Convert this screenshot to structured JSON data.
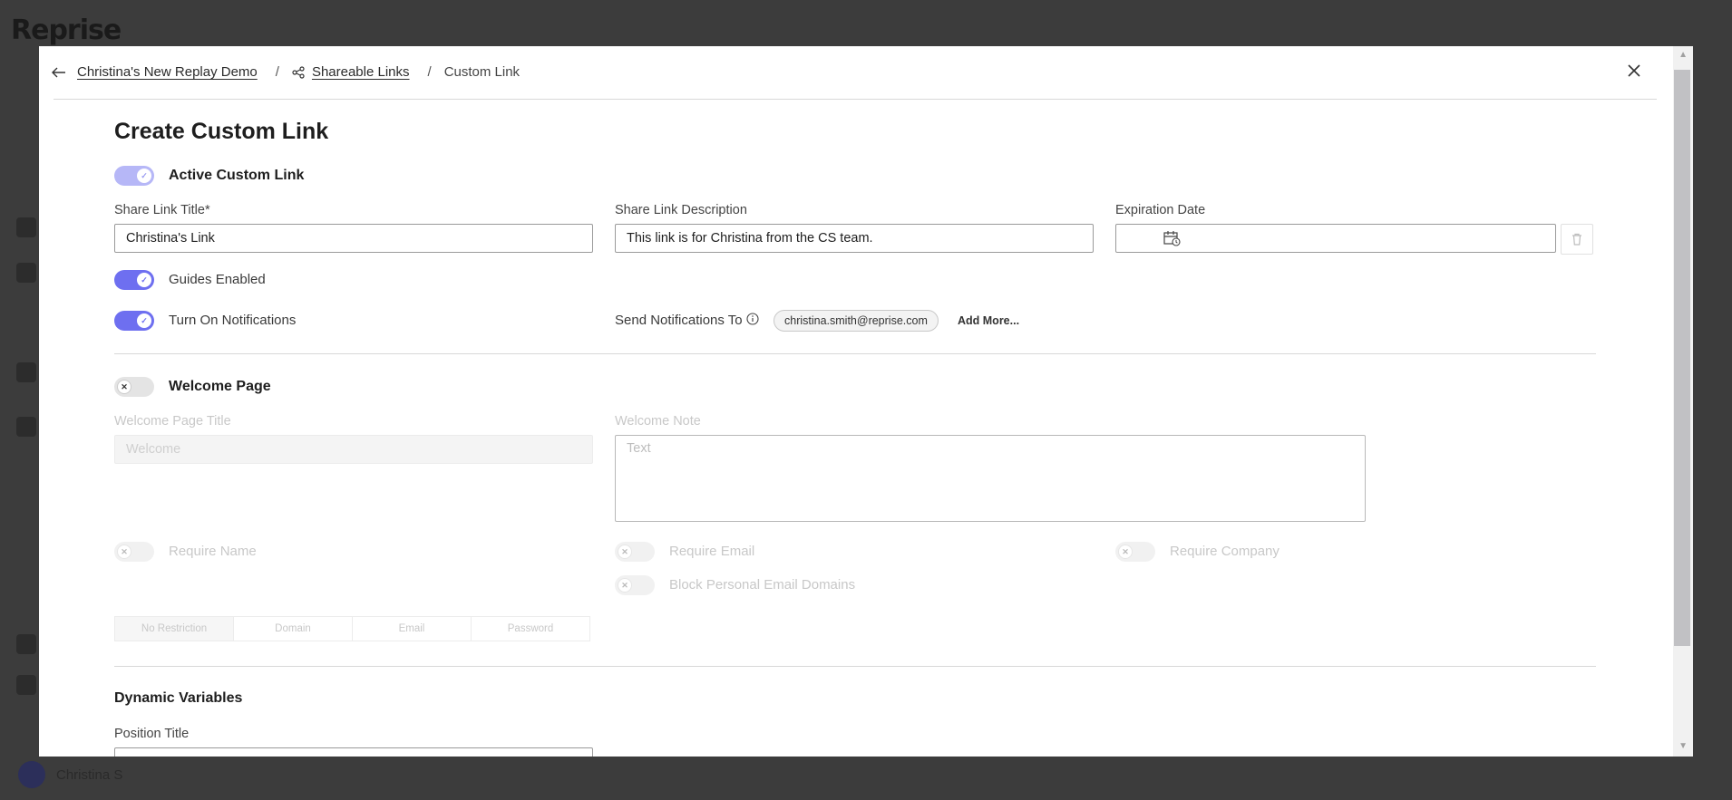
{
  "backdrop": {
    "logo": "Reprise",
    "user_name": "Christina S"
  },
  "breadcrumb": {
    "items": [
      {
        "label": "Christina's New Replay Demo",
        "icon": "arrow-left-icon"
      },
      {
        "label": "Shareable Links",
        "icon": "share-icon"
      },
      {
        "label": "Custom Link"
      }
    ]
  },
  "page": {
    "title": "Create Custom Link"
  },
  "active_toggle": {
    "label": "Active Custom Link",
    "on": true
  },
  "fields": {
    "share_title": {
      "label": "Share Link Title*",
      "value": "Christina's Link"
    },
    "share_description": {
      "label": "Share Link Description",
      "value": "This link is for Christina from the CS team."
    },
    "expiration": {
      "label": "Expiration Date",
      "value": ""
    }
  },
  "guides_toggle": {
    "label": "Guides Enabled",
    "on": true
  },
  "notifications_toggle": {
    "label": "Turn On Notifications",
    "on": true
  },
  "notifications": {
    "label": "Send Notifications To",
    "recipient": "christina.smith@reprise.com",
    "add_more": "Add More..."
  },
  "welcome": {
    "toggle_label": "Welcome Page",
    "on": false,
    "title_label": "Welcome Page Title",
    "title_placeholder": "Welcome",
    "note_label": "Welcome Note",
    "note_placeholder": "Text",
    "require_name": "Require Name",
    "require_email": "Require Email",
    "require_company": "Require Company",
    "block_domains": "Block Personal Email Domains",
    "restrictions": [
      "No Restriction",
      "Domain",
      "Email",
      "Password"
    ],
    "restriction_selected": "No Restriction"
  },
  "dynamic": {
    "heading": "Dynamic Variables",
    "position_label": "Position Title"
  },
  "colors": {
    "accent": "#6e6ff0",
    "overlay": "#3c3c3c"
  }
}
